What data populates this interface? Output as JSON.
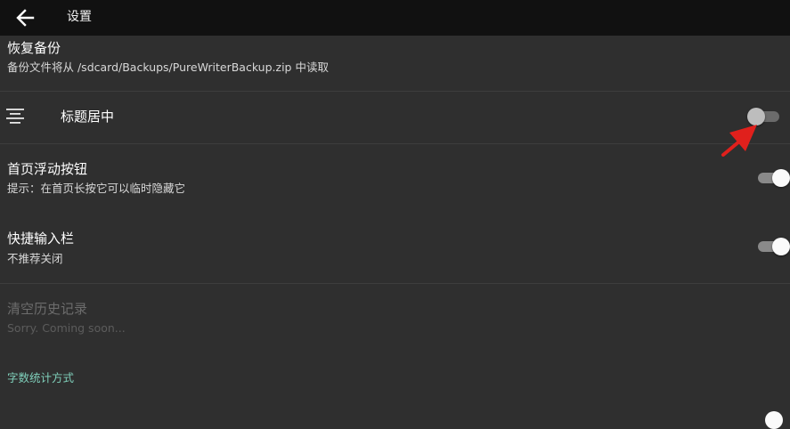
{
  "appbar": {
    "title": "设置"
  },
  "settings": {
    "restore_backup": {
      "title": "恢复备份",
      "summary": "备份文件将从 /sdcard/Backups/PureWriterBackup.zip 中读取"
    },
    "center_title": {
      "title": "标题居中",
      "enabled": false,
      "icon": "align-center-icon"
    },
    "floating_button": {
      "title": "首页浮动按钮",
      "summary": "提示：在首页长按它可以临时隐藏它",
      "enabled": true
    },
    "quick_input": {
      "title": "快捷输入栏",
      "summary": "不推荐关闭",
      "enabled": true
    },
    "clear_history": {
      "title": "清空历史记录",
      "summary": "Sorry. Coming soon...",
      "disabled": true
    },
    "word_count": {
      "category": "字数统计方式"
    }
  },
  "colors": {
    "background": "#2f2f2f",
    "appbar": "#111111",
    "accent_category": "#7fcfba",
    "annotation_arrow": "#e0201c"
  }
}
